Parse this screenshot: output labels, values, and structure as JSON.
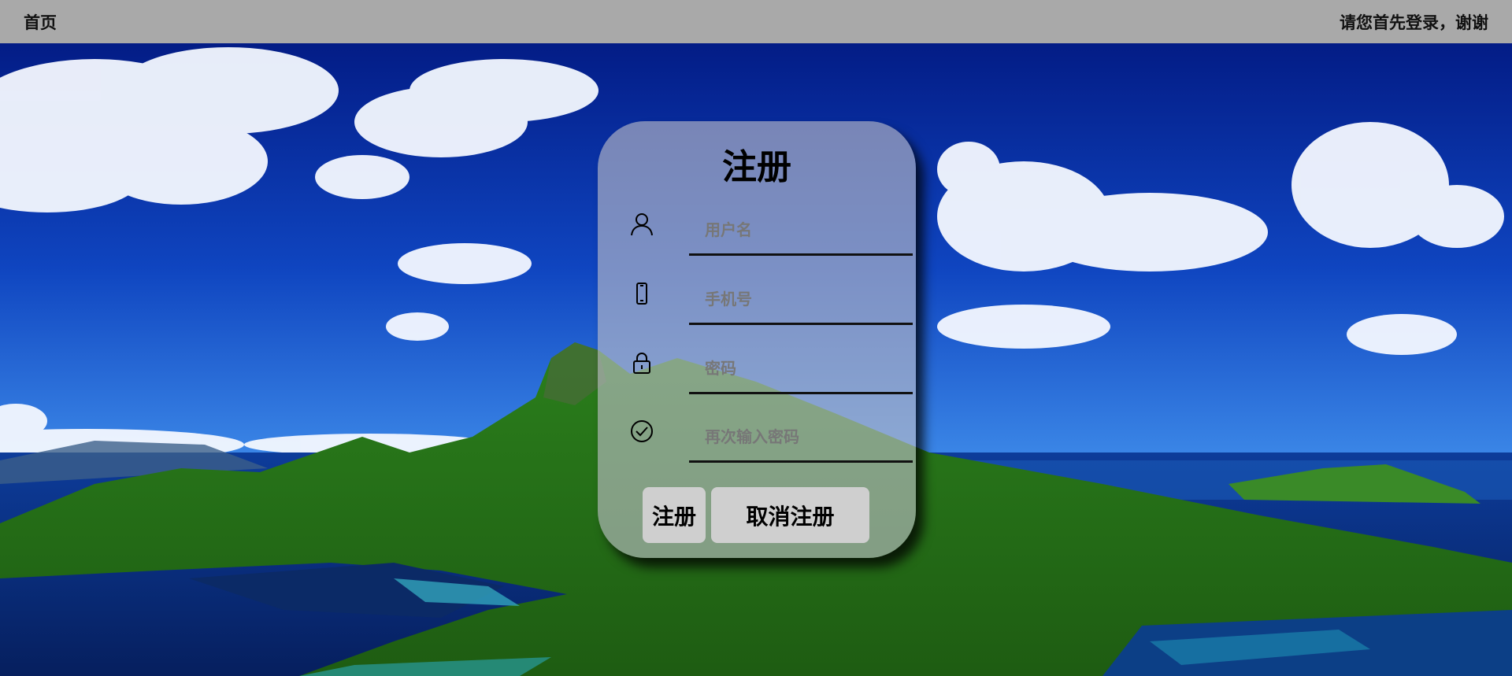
{
  "topbar": {
    "home_label": "首页",
    "notice": "请您首先登录，谢谢"
  },
  "form": {
    "title": "注册",
    "fields": [
      {
        "icon": "user-icon",
        "placeholder": "用户名",
        "value": ""
      },
      {
        "icon": "phone-icon",
        "placeholder": "手机号",
        "value": ""
      },
      {
        "icon": "lock-icon",
        "placeholder": "密码",
        "value": ""
      },
      {
        "icon": "check-circle-icon",
        "placeholder": "再次输入密码",
        "value": ""
      }
    ],
    "register_label": "注册",
    "cancel_label": "取消注册"
  },
  "colors": {
    "topbar": "#a9a9a9",
    "sky_top": "#031c86",
    "sky_bottom": "#2a6ad6",
    "sea": "#0a2f7a",
    "island_green": "#2f8a1e",
    "card_bg": "rgba(190,190,200,0.62)",
    "button_bg": "#cfcfcf"
  }
}
